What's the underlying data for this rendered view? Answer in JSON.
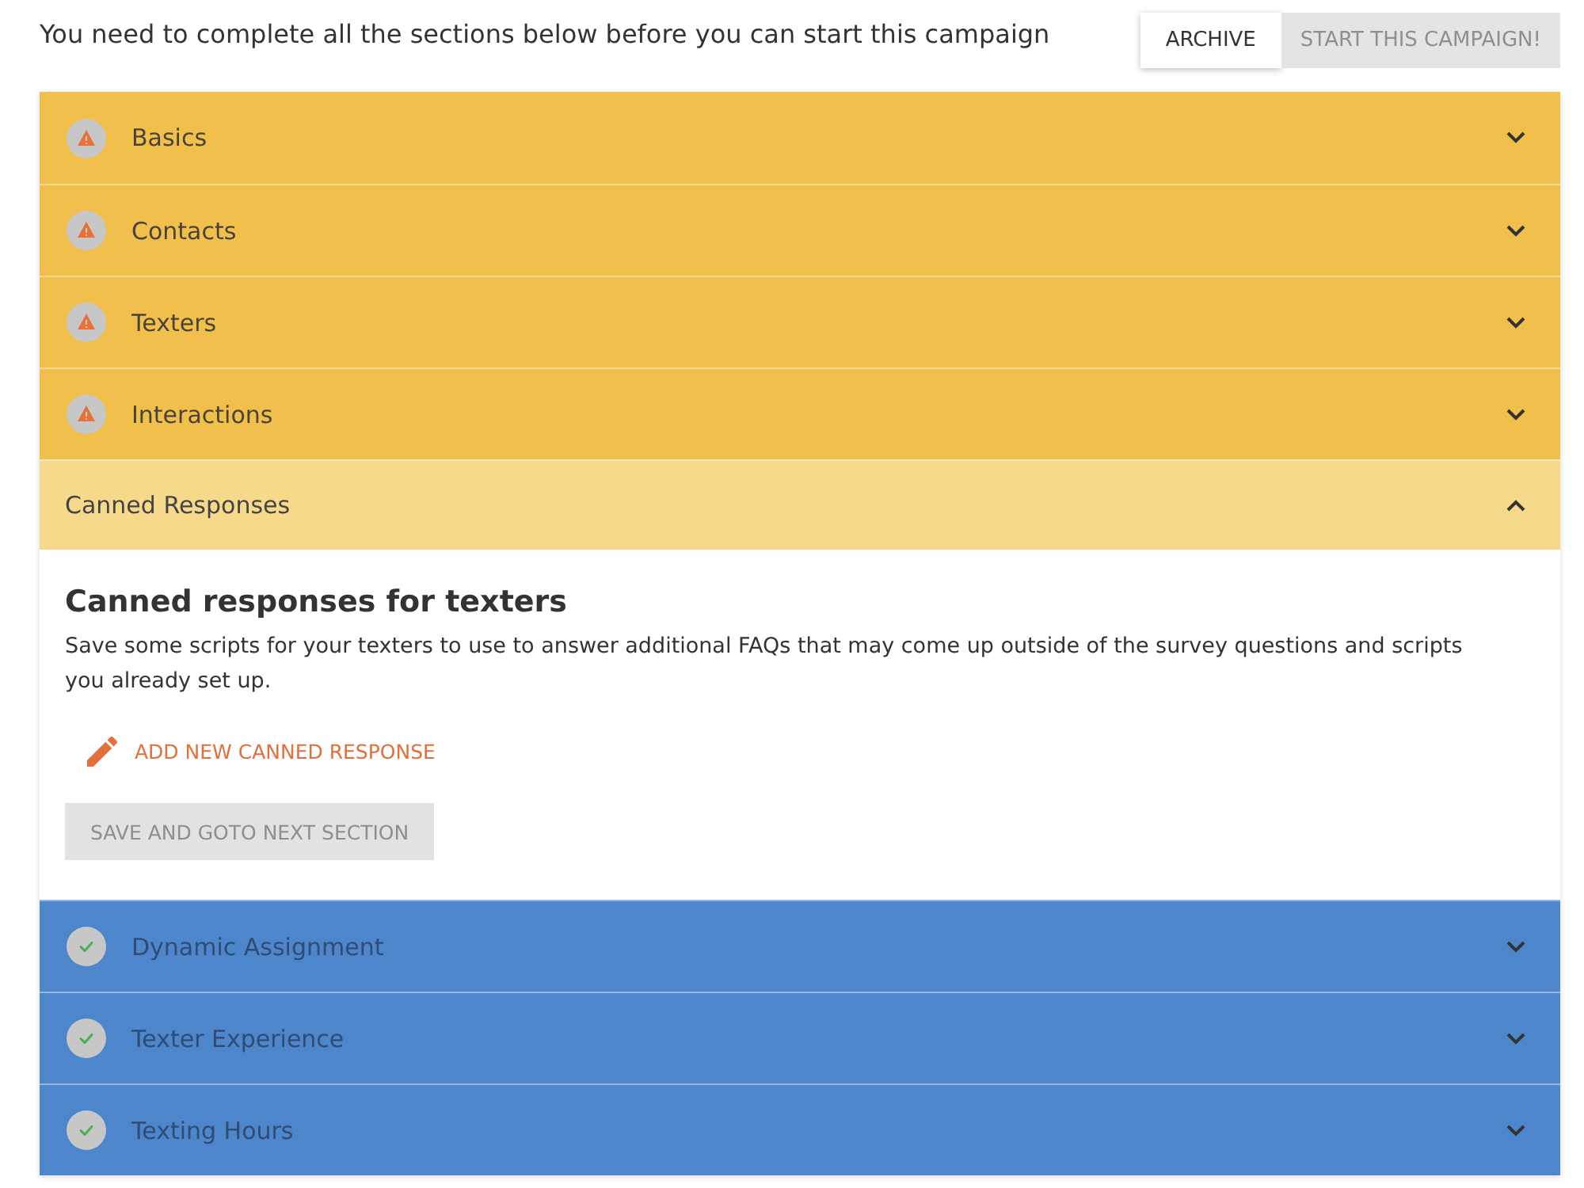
{
  "header": {
    "message": "You need to complete all the sections below before you can start this campaign",
    "buttons": [
      {
        "label": "ARCHIVE",
        "disabled": false
      },
      {
        "label": "START THIS CAMPAIGN!",
        "disabled": true
      }
    ]
  },
  "sections": [
    {
      "title": "Basics",
      "complete": false,
      "expanded": false
    },
    {
      "title": "Contacts",
      "complete": false,
      "expanded": false
    },
    {
      "title": "Texters",
      "complete": false,
      "expanded": false
    },
    {
      "title": "Interactions",
      "complete": false,
      "expanded": false
    },
    {
      "title": "Canned Responses",
      "complete": false,
      "expanded": true,
      "content": {
        "heading": "Canned responses for texters",
        "description": "Save some scripts for your texters to use to answer additional FAQs that may come up outside of the survey questions and scripts you already set up.",
        "add_button": "ADD NEW CANNED RESPONSE",
        "save_button": {
          "label": "SAVE AND GOTO NEXT SECTION",
          "disabled": true
        }
      }
    },
    {
      "title": "Dynamic Assignment",
      "complete": true,
      "expanded": false
    },
    {
      "title": "Texter Experience",
      "complete": true,
      "expanded": false
    },
    {
      "title": "Texting Hours",
      "complete": true,
      "expanded": false
    }
  ]
}
